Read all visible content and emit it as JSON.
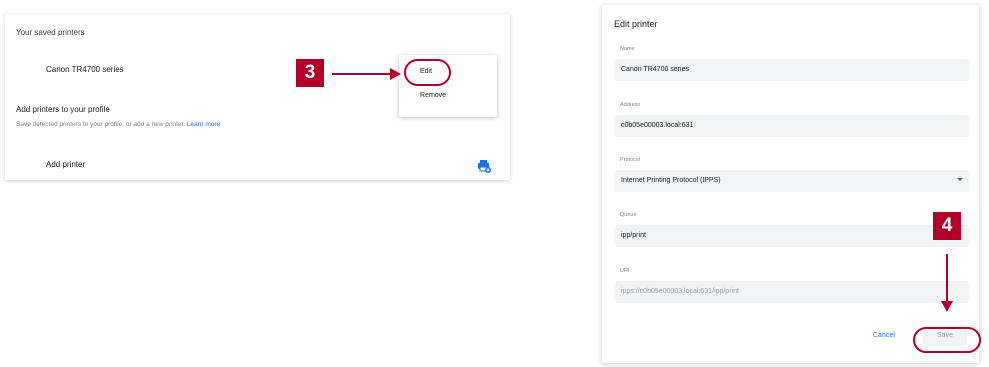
{
  "saved_printers": {
    "heading": "Your saved printers",
    "printer_name": "Canon TR4700 series",
    "add_heading": "Add printers to your profile",
    "add_subtext": "Save detected printers to your profile, or add a new printer.",
    "learn_more": "Learn more",
    "add_printer_label": "Add printer",
    "add_icon": "add-printer-icon"
  },
  "context_menu": {
    "edit_label": "Edit",
    "remove_label": "Remove"
  },
  "steps": {
    "step3": "3",
    "step4": "4"
  },
  "edit_dialog": {
    "title": "Edit printer",
    "name_label": "Name",
    "name_value": "Canon TR4700 series",
    "address_label": "Address",
    "address_value": "c0b05e00003.local:631",
    "protocol_label": "Protocol",
    "protocol_value": "Internet Printing Protocol (IPPS)",
    "queue_label": "Queue",
    "queue_value": "ipp/print",
    "uri_label": "URI",
    "uri_value": "ipps://c0b05e00003.local:631/ipp/print",
    "cancel_label": "Cancel",
    "save_label": "Save"
  },
  "colors": {
    "accent": "#b3002a",
    "link": "#1a73e8"
  }
}
